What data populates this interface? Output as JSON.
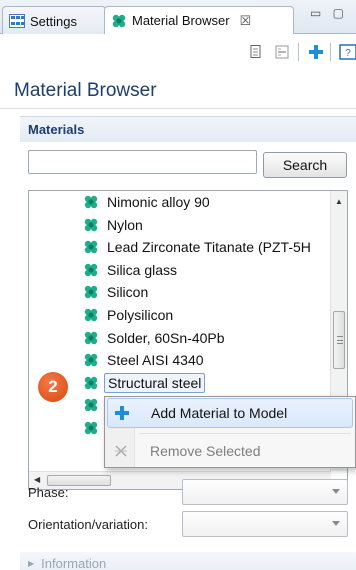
{
  "tabs": [
    {
      "label": "Settings"
    },
    {
      "label": "Material Browser",
      "close": "☒"
    }
  ],
  "page_title": "Material Browser",
  "materials_section": {
    "title": "Materials",
    "search": {
      "value": "",
      "button_label": "Search"
    }
  },
  "tree_items": [
    {
      "label": "Nimonic alloy 90"
    },
    {
      "label": "Nylon"
    },
    {
      "label": "Lead Zirconate Titanate (PZT-5H"
    },
    {
      "label": "Silica glass"
    },
    {
      "label": "Silicon"
    },
    {
      "label": "Polysilicon"
    },
    {
      "label": "Solder, 60Sn-40Pb"
    },
    {
      "label": "Steel AISI 4340"
    },
    {
      "label": "Structural steel"
    }
  ],
  "step_badge": "2",
  "context_menu": [
    {
      "label": "Add Material to Model",
      "icon": "plus-icon",
      "enabled": true
    },
    {
      "label": "Remove Selected",
      "icon": "remove-icon",
      "enabled": false
    }
  ],
  "fields": {
    "phase_label": "Phase:",
    "orientation_label": "Orientation/variation:"
  },
  "info_section": {
    "title": "Information"
  },
  "colors": {
    "title": "#1c3f6e",
    "material_icon": "#1fae8a",
    "plus": "#1e8fd6",
    "badge": "#e8601c"
  }
}
